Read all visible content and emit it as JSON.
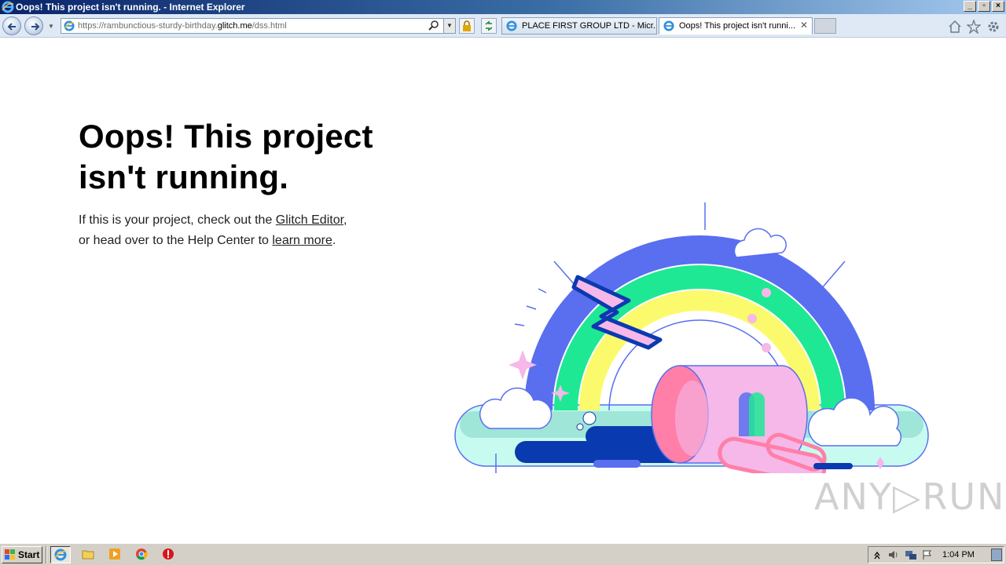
{
  "window": {
    "title": "Oops! This project isn't running. - Internet Explorer",
    "buttons": {
      "minimize": "_",
      "maximize": "▫",
      "close": "×"
    }
  },
  "addressbar": {
    "url_prefix": "https://rambunctious-sturdy-birthday.",
    "url_domain": "glitch.me",
    "url_path": "/dss.html"
  },
  "tabs": [
    {
      "label": "PLACE FIRST GROUP LTD - Micr...",
      "active": false
    },
    {
      "label": "Oops! This project isn't runni...",
      "active": true,
      "close": "✕"
    }
  ],
  "page": {
    "heading": "Oops! This project isn't running.",
    "desc_1": "If this is your project, check out the ",
    "link_editor": "Glitch Editor",
    "desc_2": ",",
    "desc_3": "or head over to the Help Center to ",
    "link_learn": "learn more",
    "desc_4": "."
  },
  "watermark": "ANY▷RUN",
  "taskbar": {
    "start_label": "Start",
    "clock": "1:04 PM",
    "icons": [
      "internet-explorer-icon",
      "folder-icon",
      "media-player-icon",
      "chrome-icon",
      "antivirus-icon"
    ]
  },
  "colors": {
    "titlebar": "#0a246a",
    "rainbow_blue": "#5a6ef0",
    "rainbow_green": "#1fe895",
    "rainbow_yellow": "#fbfa6c",
    "pink": "#f5b8e8",
    "dark_blue": "#0a3aaf",
    "mint": "#a8f0e0"
  }
}
